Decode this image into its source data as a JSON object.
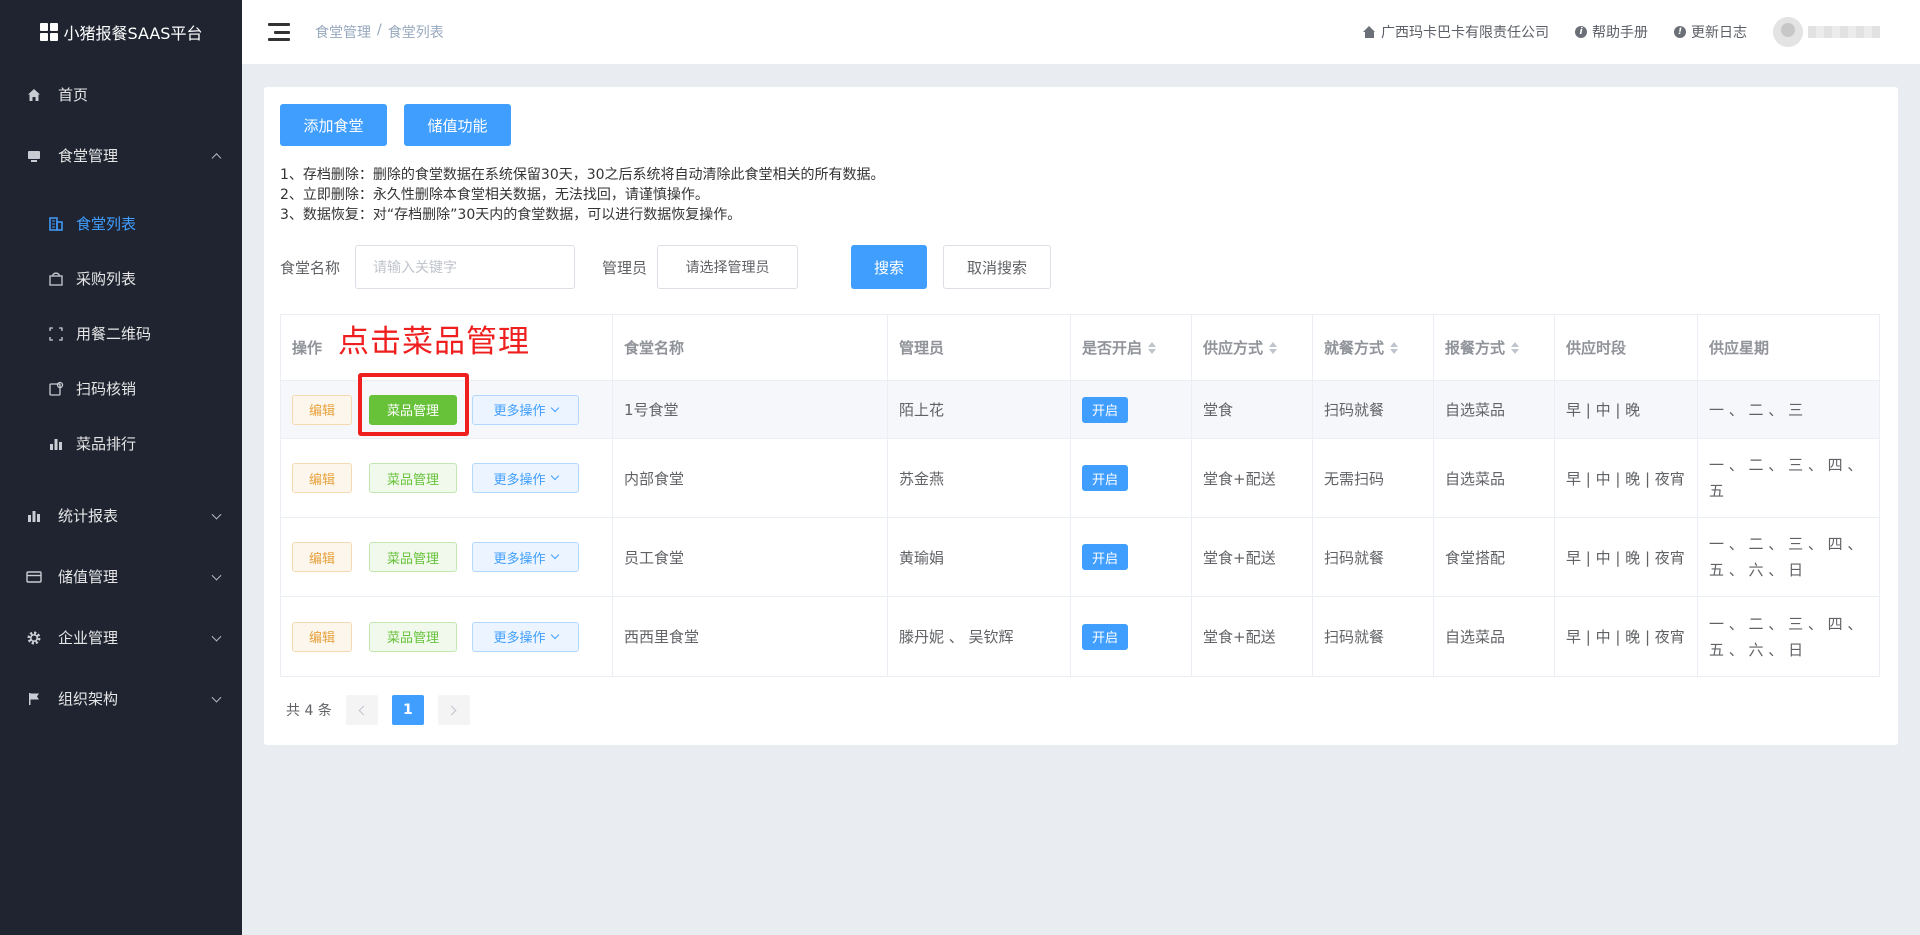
{
  "sidebar": {
    "brand": "小猪报餐SAAS平台",
    "items": [
      {
        "label": "首页",
        "icon": "home-icon"
      },
      {
        "label": "食堂管理",
        "icon": "canteen-icon",
        "expanded": true,
        "children": [
          {
            "label": "食堂列表",
            "icon": "building-icon",
            "active": true
          },
          {
            "label": "采购列表",
            "icon": "bag-icon"
          },
          {
            "label": "用餐二维码",
            "icon": "scan-frame-icon"
          },
          {
            "label": "扫码核销",
            "icon": "verify-icon"
          },
          {
            "label": "菜品排行",
            "icon": "bar-chart-icon"
          }
        ]
      },
      {
        "label": "统计报表",
        "icon": "stats-icon"
      },
      {
        "label": "储值管理",
        "icon": "card-icon"
      },
      {
        "label": "企业管理",
        "icon": "gear-icon"
      },
      {
        "label": "组织架构",
        "icon": "flag-icon"
      }
    ]
  },
  "header": {
    "breadcrumb": [
      "食堂管理",
      "食堂列表"
    ],
    "breadcrumb_sep": "/",
    "company": "广西玛卡巴卡有限责任公司",
    "help": "帮助手册",
    "changelog": "更新日志"
  },
  "toolbar": {
    "add_label": "添加食堂",
    "stored_value_label": "储值功能"
  },
  "notes": [
    "1、存档删除：删除的食堂数据在系统保留30天，30之后系统将自动清除此食堂相关的所有数据。",
    "2、立即删除：永久性删除本食堂相关数据，无法找回，请谨慎操作。",
    "3、数据恢复：对“存档删除”30天内的食堂数据，可以进行数据恢复操作。"
  ],
  "search": {
    "name_label": "食堂名称",
    "name_placeholder": "请输入关键字",
    "admin_label": "管理员",
    "admin_select": "请选择管理员",
    "search_btn": "搜索",
    "cancel_btn": "取消搜索"
  },
  "table": {
    "columns": [
      "操作",
      "食堂名称",
      "管理员",
      "是否开启",
      "供应方式",
      "就餐方式",
      "报餐方式",
      "供应时段",
      "供应星期"
    ],
    "row_actions": {
      "edit": "编辑",
      "dish": "菜品管理",
      "more": "更多操作"
    },
    "rows": [
      {
        "name": "1号食堂",
        "admin": "陌上花",
        "enabled": "开启",
        "supply": "堂食",
        "dining": "扫码就餐",
        "order": "自选菜品",
        "periods": "早 | 中 | 晚",
        "weekdays": "一 、 二 、 三"
      },
      {
        "name": "内部食堂",
        "admin": "苏金燕",
        "enabled": "开启",
        "supply": "堂食+配送",
        "dining": "无需扫码",
        "order": "自选菜品",
        "periods": "早 | 中 | 晚 | 夜宵",
        "weekdays": "一 、 二 、 三 、 四 、 五"
      },
      {
        "name": "员工食堂",
        "admin": "黄瑜娟",
        "enabled": "开启",
        "supply": "堂食+配送",
        "dining": "扫码就餐",
        "order": "食堂搭配",
        "periods": "早 | 中 | 晚 | 夜宵",
        "weekdays": "一 、 二 、 三 、 四 、 五 、 六 、 日"
      },
      {
        "name": "西西里食堂",
        "admin": "滕丹妮 、 吴钦辉",
        "enabled": "开启",
        "supply": "堂食+配送",
        "dining": "扫码就餐",
        "order": "自选菜品",
        "periods": "早 | 中 | 晚 | 夜宵",
        "weekdays": "一 、 二 、 三 、 四 、 五 、 六 、 日"
      }
    ]
  },
  "annotation": {
    "text": "点击菜品管理",
    "color": "#f01f1f"
  },
  "pagination": {
    "total": "共 4 条",
    "current": "1"
  },
  "colors": {
    "primary": "#409eff",
    "success": "#67c23a",
    "warning": "#e6a23c",
    "sidebar_bg": "#1f2430"
  }
}
